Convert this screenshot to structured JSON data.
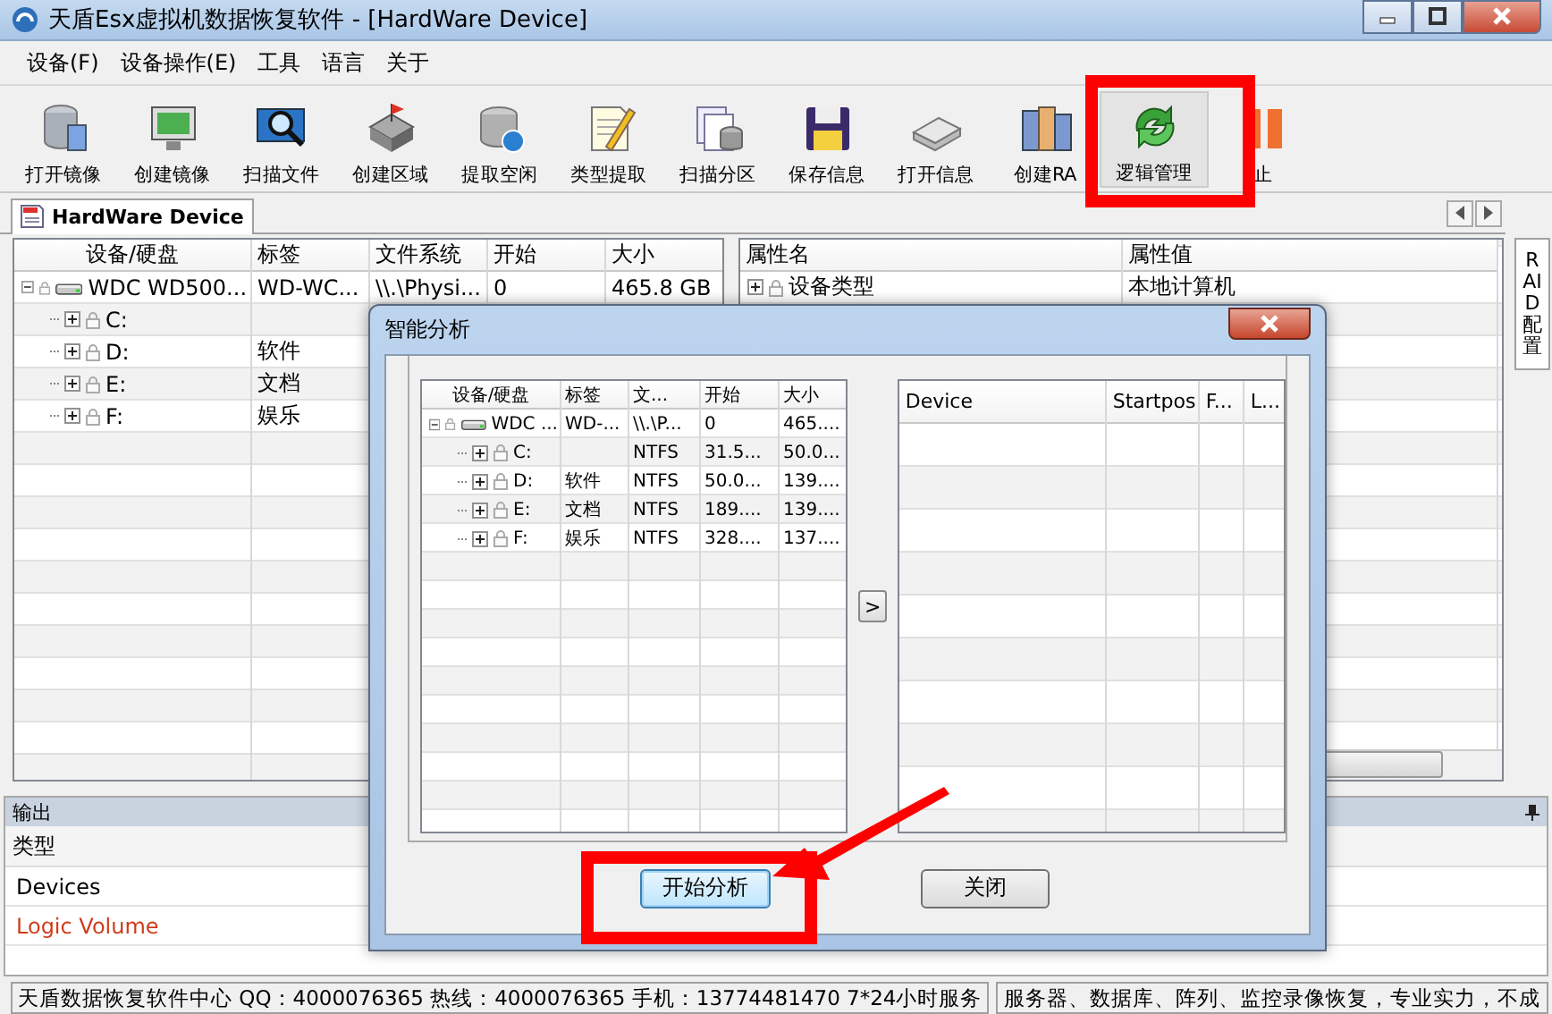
{
  "window": {
    "title": "天盾Esx虚拟机数据恢复软件 - [HardWare Device]"
  },
  "menu": [
    "设备(F)",
    "设备操作(E)",
    "工具",
    "语言",
    "关于"
  ],
  "toolbar": [
    "打开镜像",
    "创建镜像",
    "扫描文件",
    "创建区域",
    "提取空闲",
    "类型提取",
    "扫描分区",
    "保存信息",
    "打开信息",
    "创建RA",
    "逻辑管理",
    "止"
  ],
  "document_tab": {
    "label": "HardWare Device",
    "selected": true
  },
  "device_table": {
    "columns": [
      "设备/硬盘",
      "标签",
      "文件系统",
      "开始",
      "大小"
    ],
    "rows": [
      {
        "cells": [
          "WDC WD500...",
          "WD-WC...",
          "\\\\.\\Physi...",
          "0",
          "465.8 GB"
        ],
        "expanded": true,
        "children": [
          {
            "cells": [
              "C:"
            ],
            "expanded": false
          },
          {
            "cells": [
              "D:",
              "软件"
            ],
            "expanded": false
          },
          {
            "cells": [
              "E:",
              "文档"
            ],
            "expanded": false
          },
          {
            "cells": [
              "F:",
              "娱乐"
            ],
            "expanded": false
          }
        ]
      }
    ]
  },
  "property_table": {
    "columns": [
      "属性名",
      "属性值"
    ],
    "rows": [
      {
        "cells": [
          "设备类型",
          "本地计算机"
        ],
        "expanded": false
      }
    ]
  },
  "side_tab": "RAID配置",
  "output": {
    "title": "输出",
    "columns": [
      "类型"
    ],
    "rows": [
      {
        "text": "Devices",
        "color": "#000000"
      },
      {
        "text": "Logic Volume",
        "color": "#d03c1c"
      }
    ]
  },
  "status_bar": [
    "天盾数据恢复软件中心 QQ：4000076365 热线：4000076365 手机：13774481470   7*24小时服务",
    "服务器、数据库、阵列、监控录像恢复，专业实力，不成"
  ],
  "dialog": {
    "title": "智能分析",
    "tree": {
      "columns": [
        "设备/硬盘",
        "标签",
        "文...",
        "开始",
        "大小"
      ],
      "rows": [
        {
          "cells": [
            "WDC ...",
            "WD-...",
            "\\\\.\\P...",
            "0",
            "465...."
          ],
          "expanded": true,
          "children": [
            {
              "cells": [
                "C:",
                "",
                "NTFS",
                "31.5...",
                "50.0..."
              ],
              "expanded": false
            },
            {
              "cells": [
                "D:",
                "软件",
                "NTFS",
                "50.0...",
                "139...."
              ],
              "expanded": false
            },
            {
              "cells": [
                "E:",
                "文档",
                "NTFS",
                "189....",
                "139...."
              ],
              "expanded": false
            },
            {
              "cells": [
                "F:",
                "娱乐",
                "NTFS",
                "328....",
                "137...."
              ],
              "expanded": false
            }
          ]
        }
      ]
    },
    "move_button": ">",
    "result_list": {
      "columns": [
        "Device",
        "Startpos",
        "F...",
        "L..."
      ]
    },
    "buttons": [
      {
        "label": "开始分析",
        "focused": true
      },
      {
        "label": "关闭",
        "focused": false
      }
    ]
  }
}
